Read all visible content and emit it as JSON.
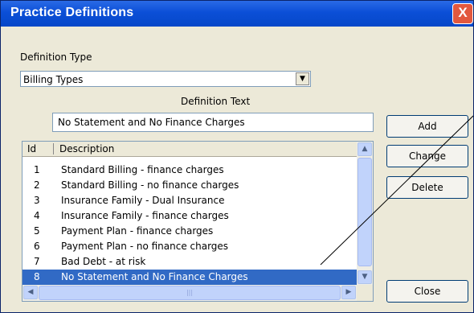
{
  "window": {
    "title": "Practice Definitions",
    "close_label": "X"
  },
  "definition_type": {
    "label": "Definition Type",
    "selected": "Billing Types"
  },
  "definition_text": {
    "label": "Definition Text",
    "value": "No Statement and No Finance Charges"
  },
  "buttons": {
    "add": "Add",
    "change": "Change",
    "delete": "Delete",
    "close": "Close"
  },
  "list": {
    "columns": [
      "Id",
      "Description"
    ],
    "rows": [
      {
        "id": "1",
        "description": "Standard Billing - finance charges"
      },
      {
        "id": "2",
        "description": "Standard Billing - no finance charges"
      },
      {
        "id": "3",
        "description": "Insurance Family - Dual Insurance"
      },
      {
        "id": "4",
        "description": "Insurance Family - finance charges"
      },
      {
        "id": "5",
        "description": "Payment Plan - finance charges"
      },
      {
        "id": "6",
        "description": "Payment Plan - no finance charges"
      },
      {
        "id": "7",
        "description": "Bad Debt - at risk"
      },
      {
        "id": "8",
        "description": "No Statement and No Finance Charges"
      }
    ],
    "selected_index": 7
  },
  "colors": {
    "titlebar": "#0b4fd7",
    "selection": "#316ac5",
    "window_bg": "#ece9d8"
  }
}
